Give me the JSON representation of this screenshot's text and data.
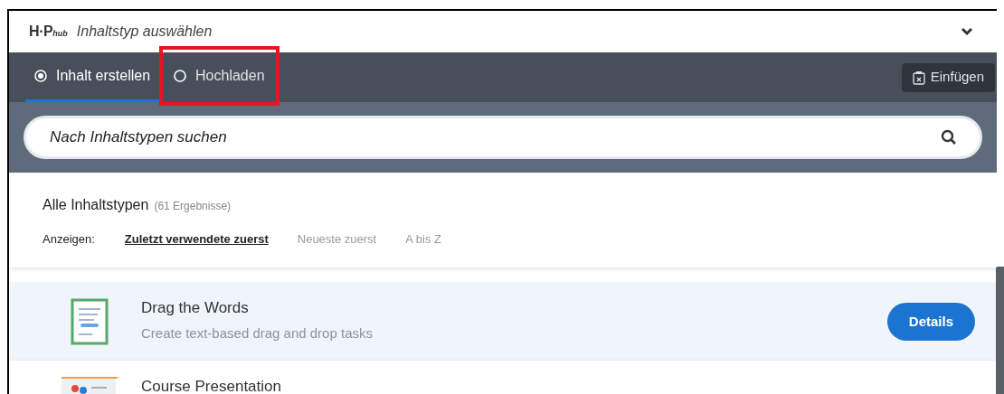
{
  "header": {
    "logo": "H·P",
    "logo_suffix": "hub",
    "title": "Inhaltstyp auswählen"
  },
  "tabs": [
    {
      "label": "Inhalt erstellen",
      "selected": true,
      "highlighted": false
    },
    {
      "label": "Hochladen",
      "selected": false,
      "highlighted": true
    }
  ],
  "paste_button": "Einfügen",
  "search": {
    "placeholder": "Nach Inhaltstypen suchen"
  },
  "results": {
    "title": "Alle Inhaltstypen",
    "count": "(61 Ergebnisse)",
    "sort_label": "Anzeigen:",
    "sort_options": [
      {
        "label": "Zuletzt verwendete zuerst",
        "selected": true
      },
      {
        "label": "Neueste zuerst",
        "selected": false
      },
      {
        "label": "A bis Z",
        "selected": false
      }
    ]
  },
  "content_types": [
    {
      "kind": "drag-words",
      "title": "Drag the Words",
      "description": "Create text-based drag and drop tasks",
      "button": "Details",
      "selected": true
    },
    {
      "kind": "presentation",
      "title": "Course Presentation",
      "selected": false
    }
  ]
}
